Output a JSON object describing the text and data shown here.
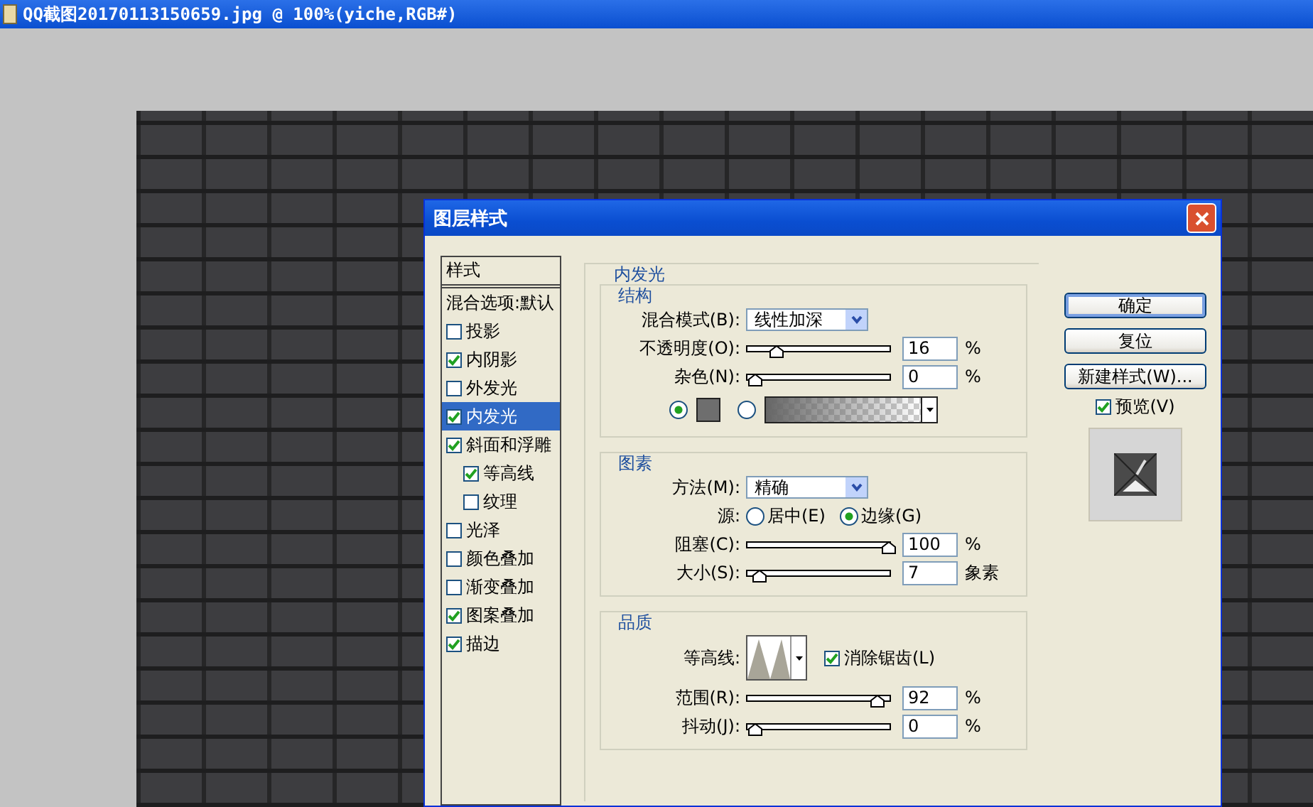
{
  "app_title": "QQ截图20170113150659.jpg @ 100%(yiche,RGB#)",
  "dialog": {
    "title": "图层样式",
    "styles": {
      "header": "样式",
      "items": [
        {
          "kind": "plain",
          "label": "混合选项:默认",
          "selected": false
        },
        {
          "kind": "check",
          "label": "投影",
          "checked": false,
          "selected": false
        },
        {
          "kind": "check",
          "label": "内阴影",
          "checked": true,
          "selected": false
        },
        {
          "kind": "check",
          "label": "外发光",
          "checked": false,
          "selected": false
        },
        {
          "kind": "check",
          "label": "内发光",
          "checked": true,
          "selected": true
        },
        {
          "kind": "check",
          "label": "斜面和浮雕",
          "checked": true,
          "selected": false,
          "children": [
            {
              "kind": "check",
              "label": "等高线",
              "checked": true,
              "selected": false
            },
            {
              "kind": "check",
              "label": "纹理",
              "checked": false,
              "selected": false
            }
          ]
        },
        {
          "kind": "check",
          "label": "光泽",
          "checked": false,
          "selected": false
        },
        {
          "kind": "check",
          "label": "颜色叠加",
          "checked": false,
          "selected": false
        },
        {
          "kind": "check",
          "label": "渐变叠加",
          "checked": false,
          "selected": false
        },
        {
          "kind": "check",
          "label": "图案叠加",
          "checked": true,
          "selected": false
        },
        {
          "kind": "check",
          "label": "描边",
          "checked": true,
          "selected": false
        }
      ]
    },
    "panel": {
      "title": "内发光",
      "sections": [
        {
          "title": "结构",
          "rows": [
            {
              "kind": "select",
              "label": "混合模式(B):",
              "value": "线性加深"
            },
            {
              "kind": "slider",
              "label": "不透明度(O):",
              "level": 0.16,
              "value": "16",
              "unit": "%"
            },
            {
              "kind": "slider",
              "label": "杂色(N):",
              "level": 0,
              "value": "0",
              "unit": "%"
            },
            {
              "kind": "fill",
              "options": [
                {
                  "kind": "color",
                  "selected": true
                },
                {
                  "kind": "gradient",
                  "selected": false
                }
              ]
            }
          ]
        },
        {
          "title": "图素",
          "rows": [
            {
              "kind": "select",
              "label": "方法(M):",
              "value": "精确"
            },
            {
              "kind": "radio",
              "label": "源:",
              "options": [
                {
                  "label": "居中(E)",
                  "selected": false
                },
                {
                  "label": "边缘(G)",
                  "selected": true
                }
              ]
            },
            {
              "kind": "slider",
              "label": "阻塞(C):",
              "level": 1,
              "value": "100",
              "unit": "%"
            },
            {
              "kind": "slider",
              "label": "大小(S):",
              "level": 0.03,
              "value": "7",
              "unit": "象素"
            }
          ]
        },
        {
          "title": "品质",
          "rows": [
            {
              "kind": "contour",
              "label": "等高线:",
              "checkbox": {
                "label": "消除锯齿(L)",
                "checked": true
              }
            },
            {
              "kind": "slider",
              "label": "范围(R):",
              "level": 0.92,
              "value": "92",
              "unit": "%"
            },
            {
              "kind": "slider",
              "label": "抖动(J):",
              "level": 0,
              "value": "0",
              "unit": "%"
            }
          ]
        }
      ]
    },
    "buttons": [
      {
        "label": "确定",
        "default": true
      },
      {
        "label": "复位",
        "default": false
      },
      {
        "label": "新建样式(W)...",
        "default": false
      }
    ],
    "preview": {
      "label": "预览(V)",
      "checked": true
    }
  }
}
